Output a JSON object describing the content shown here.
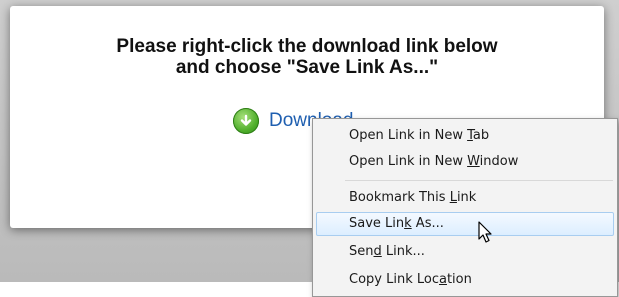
{
  "dialog": {
    "line1": "Please right-click the download link below",
    "line2": "and choose \"Save Link As...\""
  },
  "download": {
    "label": "Download",
    "icon": "download-arrow-icon",
    "color": "#1f5fb0"
  },
  "context_menu": {
    "highlighted_item": "Save Link As...",
    "items": [
      {
        "before": "Open Link in New ",
        "key": "T",
        "after": "ab"
      },
      {
        "before": "Open Link in New ",
        "key": "W",
        "after": "indow"
      },
      {
        "before": "Bookmark This ",
        "key": "L",
        "after": "ink"
      },
      {
        "before": "Save Lin",
        "key": "k",
        "after": " As..."
      },
      {
        "before": "Sen",
        "key": "d",
        "after": " Link..."
      },
      {
        "before": "Copy Link Loc",
        "key": "a",
        "after": "tion"
      }
    ]
  }
}
